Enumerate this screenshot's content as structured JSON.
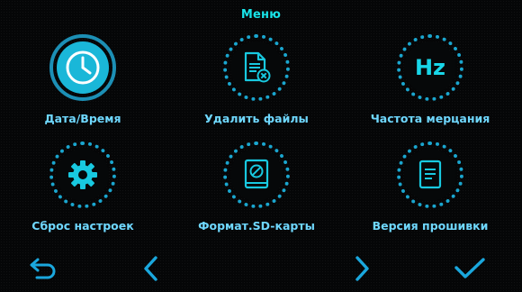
{
  "header": {
    "title": "Меню"
  },
  "menu": {
    "items": [
      {
        "label": "Дата/Время",
        "icon": "clock-icon",
        "selected": true
      },
      {
        "label": "Удалить файлы",
        "icon": "delete-file-icon",
        "selected": false
      },
      {
        "label": "Частота мерцания",
        "icon": "frequency-icon",
        "icon_text": "Hz",
        "selected": false
      },
      {
        "label": "Сброс настроек",
        "icon": "gear-icon",
        "selected": false
      },
      {
        "label": "Формат.SD-карты",
        "icon": "sd-format-icon",
        "selected": false
      },
      {
        "label": "Версия прошивки",
        "icon": "document-icon",
        "selected": false
      }
    ]
  },
  "nav": {
    "buttons": [
      "back-icon",
      "chevron-left-icon",
      "chevron-right-icon",
      "checkmark-icon"
    ]
  },
  "colors": {
    "accent": "#18e3e8",
    "ring": "#1aa6cf",
    "label": "#6fd8ff",
    "selected_fill": "#1ab7d8"
  }
}
